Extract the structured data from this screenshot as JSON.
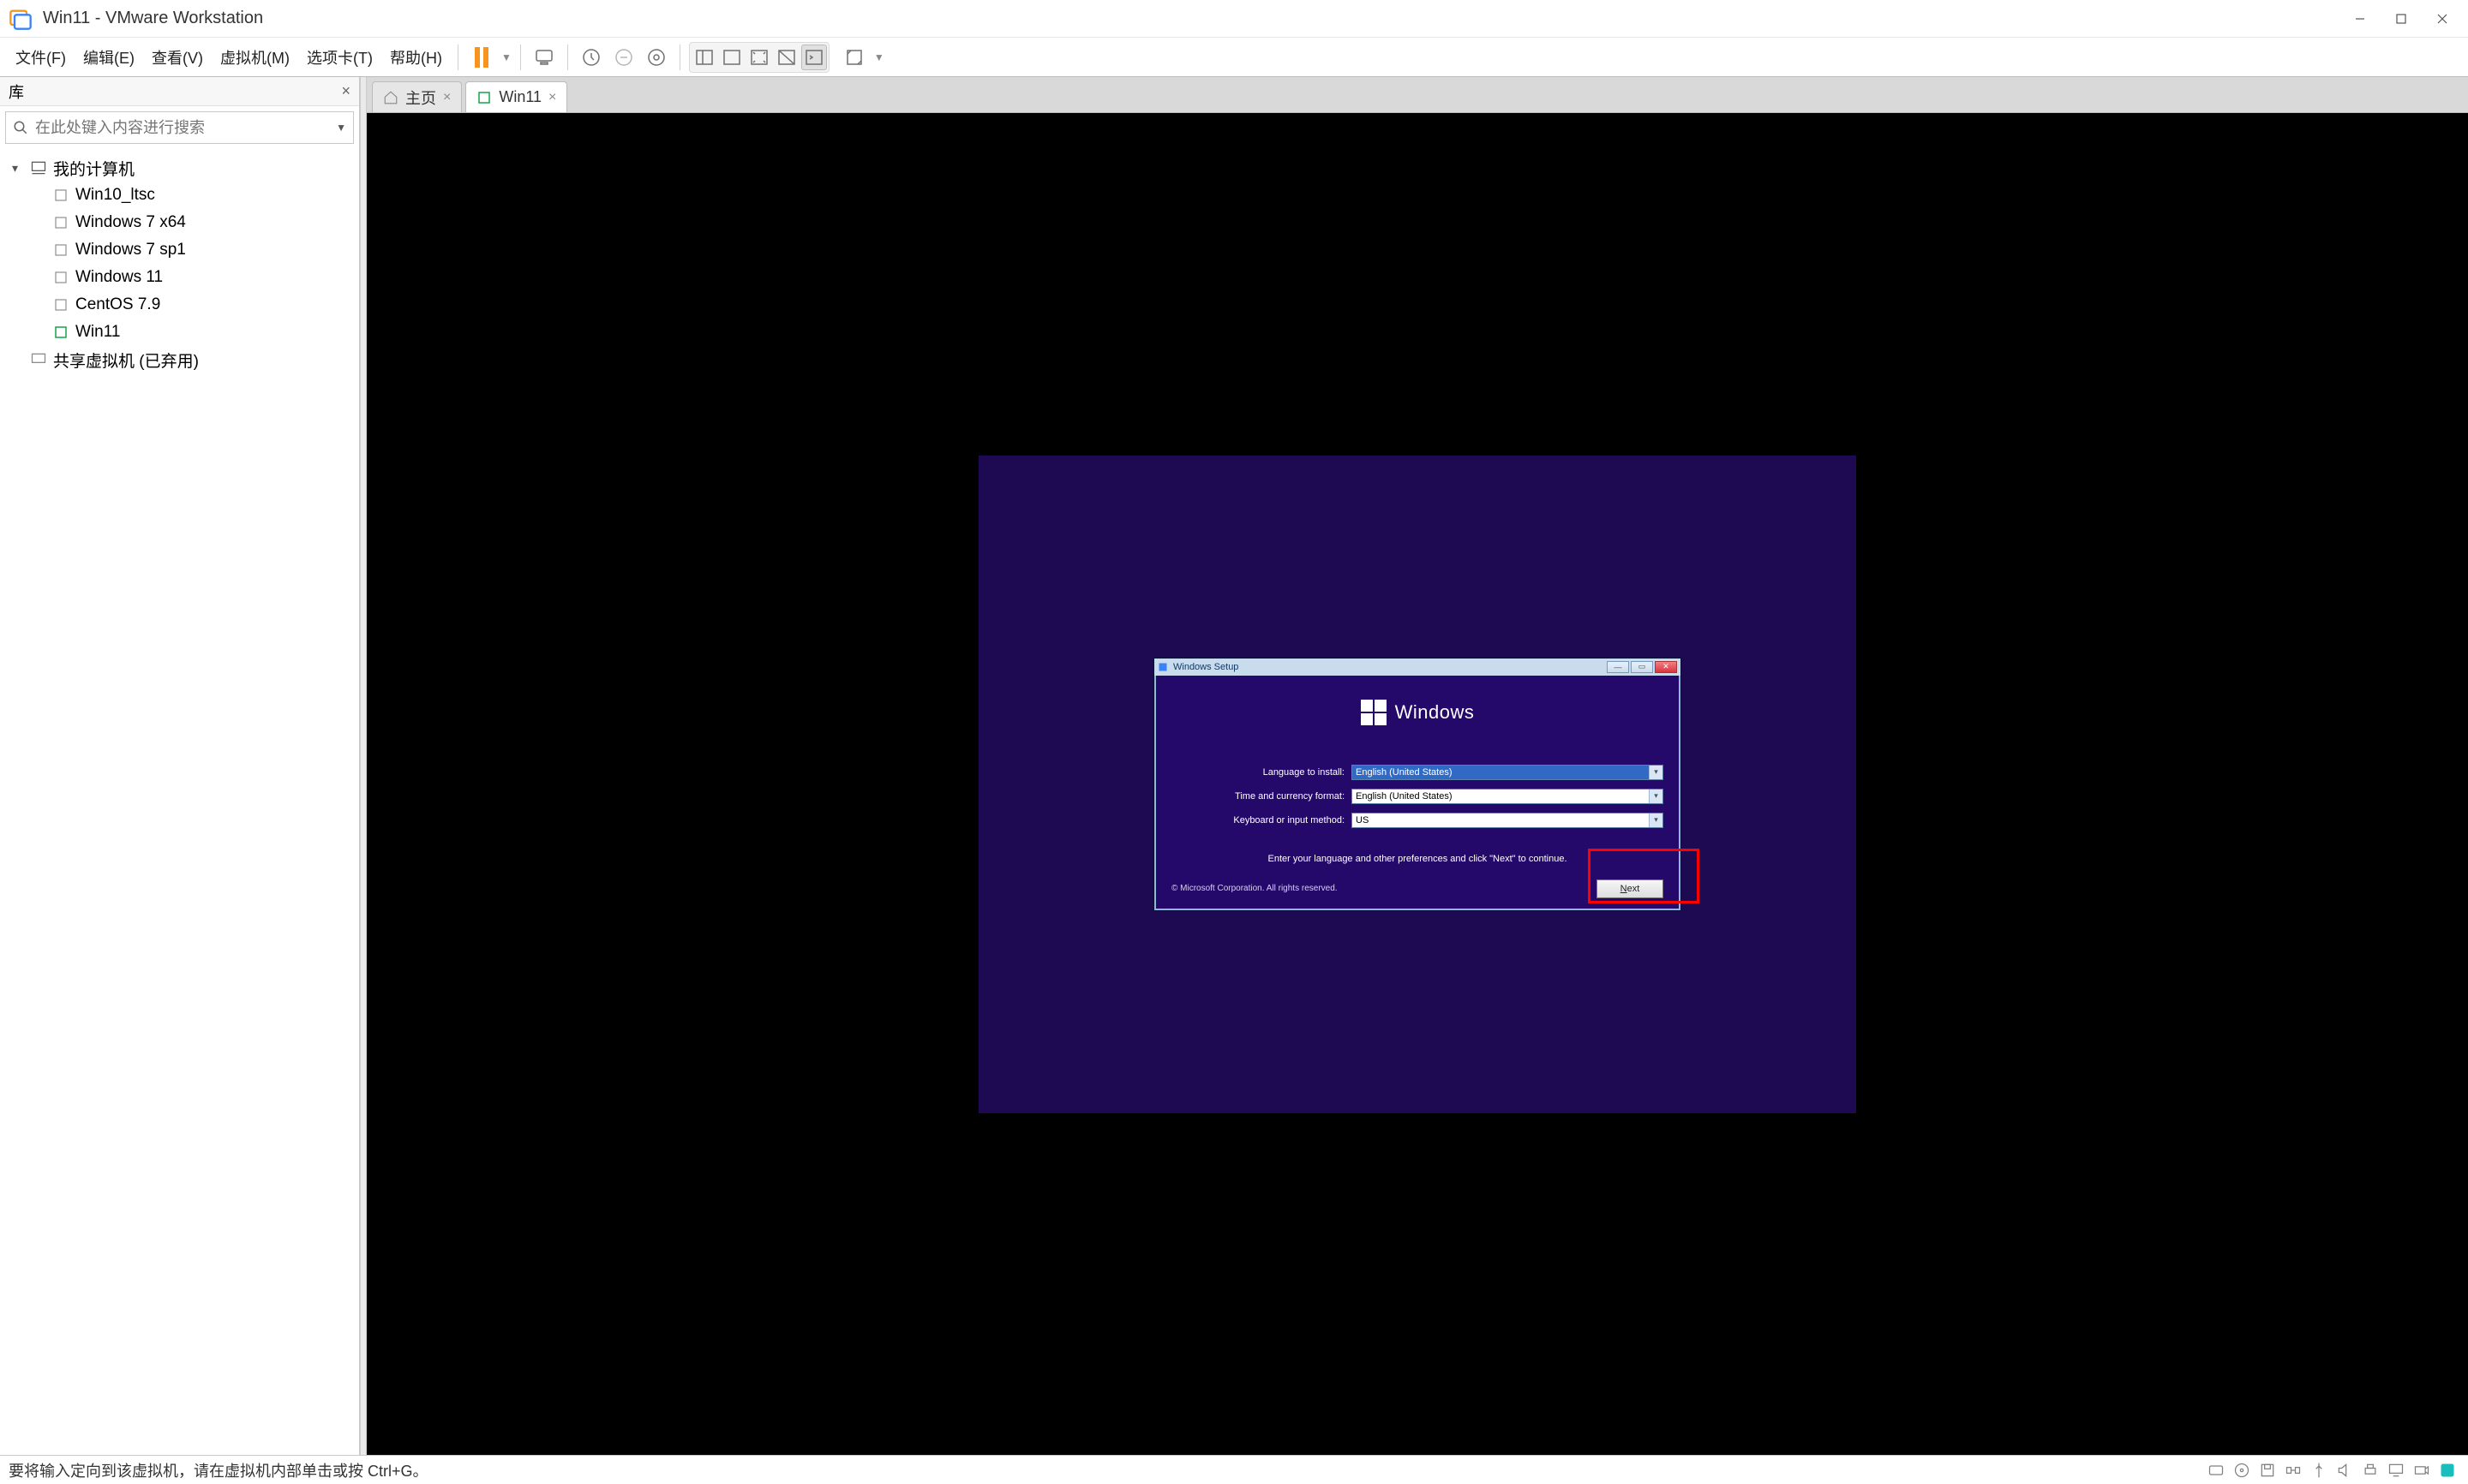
{
  "titlebar": {
    "title": "Win11 - VMware Workstation"
  },
  "menu": {
    "file": "文件(F)",
    "edit": "编辑(E)",
    "view": "查看(V)",
    "vm": "虚拟机(M)",
    "tabs": "选项卡(T)",
    "help": "帮助(H)"
  },
  "sidebar": {
    "header": "库",
    "search_placeholder": "在此处键入内容进行搜索",
    "root": "我的计算机",
    "vms": [
      {
        "label": "Win10_ltsc"
      },
      {
        "label": "Windows 7 x64"
      },
      {
        "label": "Windows 7 sp1"
      },
      {
        "label": "Windows 11"
      },
      {
        "label": "CentOS 7.9"
      },
      {
        "label": "Win11",
        "active": true
      }
    ],
    "shared": "共享虚拟机 (已弃用)"
  },
  "tabs": {
    "home": "主页",
    "vm": "Win11"
  },
  "setup": {
    "title": "Windows Setup",
    "brand": "Windows",
    "lang_label": "Language to install:",
    "lang_value": "English (United States)",
    "time_label": "Time and currency format:",
    "time_value": "English (United States)",
    "kb_label": "Keyboard or input method:",
    "kb_value": "US",
    "hint": "Enter your language and other preferences and click \"Next\" to continue.",
    "copyright": "© Microsoft Corporation. All rights reserved.",
    "next": "Next"
  },
  "statusbar": {
    "hint": "要将输入定向到该虚拟机，请在虚拟机内部单击或按 Ctrl+G。"
  }
}
